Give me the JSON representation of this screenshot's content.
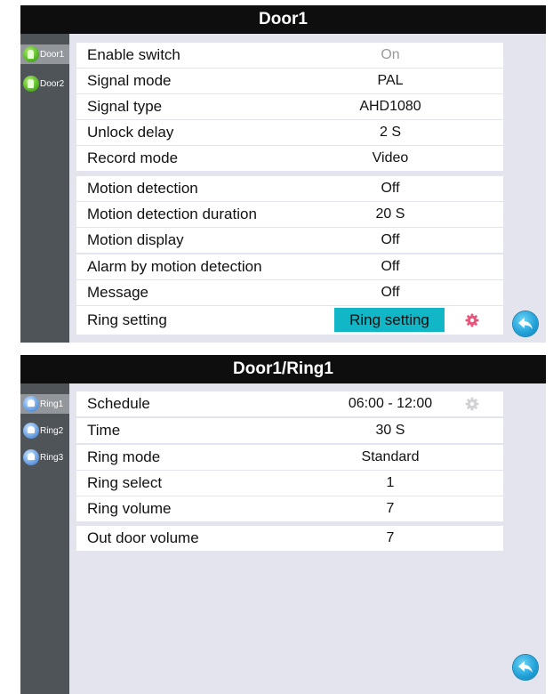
{
  "door_panel": {
    "title": "Door1",
    "sidebar": [
      {
        "label": "Door1",
        "icon": "door-icon"
      },
      {
        "label": "Door2",
        "icon": "door-icon"
      }
    ],
    "rows": [
      {
        "label": "Enable switch",
        "value": "On"
      },
      {
        "label": "Signal mode",
        "value": "PAL"
      },
      {
        "label": "Signal type",
        "value": "AHD1080"
      },
      {
        "label": "Unlock delay",
        "value": "2 S"
      },
      {
        "label": "Record mode",
        "value": "Video"
      },
      {
        "label": "Motion detection",
        "value": "Off"
      },
      {
        "label": "Motion detection duration",
        "value": "20 S"
      },
      {
        "label": "Motion display",
        "value": "Off"
      },
      {
        "label": "Alarm by motion detection",
        "value": "Off"
      },
      {
        "label": "Message",
        "value": "Off"
      },
      {
        "label": "Ring setting",
        "button": "Ring setting"
      }
    ],
    "back_icon": "back-arrow-icon"
  },
  "ring_panel": {
    "title": "Door1/Ring1",
    "sidebar": [
      {
        "label": "Ring1",
        "icon": "bell-icon"
      },
      {
        "label": "Ring2",
        "icon": "bell-icon"
      },
      {
        "label": "Ring3",
        "icon": "bell-icon"
      }
    ],
    "rows": [
      {
        "label": "Schedule",
        "value": "06:00 - 12:00"
      },
      {
        "label": "Time",
        "value": "30 S"
      },
      {
        "label": "Ring mode",
        "value": "Standard"
      },
      {
        "label": "Ring select",
        "value": "1"
      },
      {
        "label": "Ring volume",
        "value": "7"
      },
      {
        "label": "Out door volume",
        "value": "7"
      }
    ],
    "back_icon": "back-arrow-icon"
  },
  "colors": {
    "title_bar": "#0e0e0e",
    "panel_background": "#e4e4ee",
    "sidebar": "#4f5459",
    "sidebar_active": "#93979c",
    "ring_button": "#11b7c7",
    "gear_active": "#e8537a",
    "gear_inactive": "#d2d2d6"
  }
}
